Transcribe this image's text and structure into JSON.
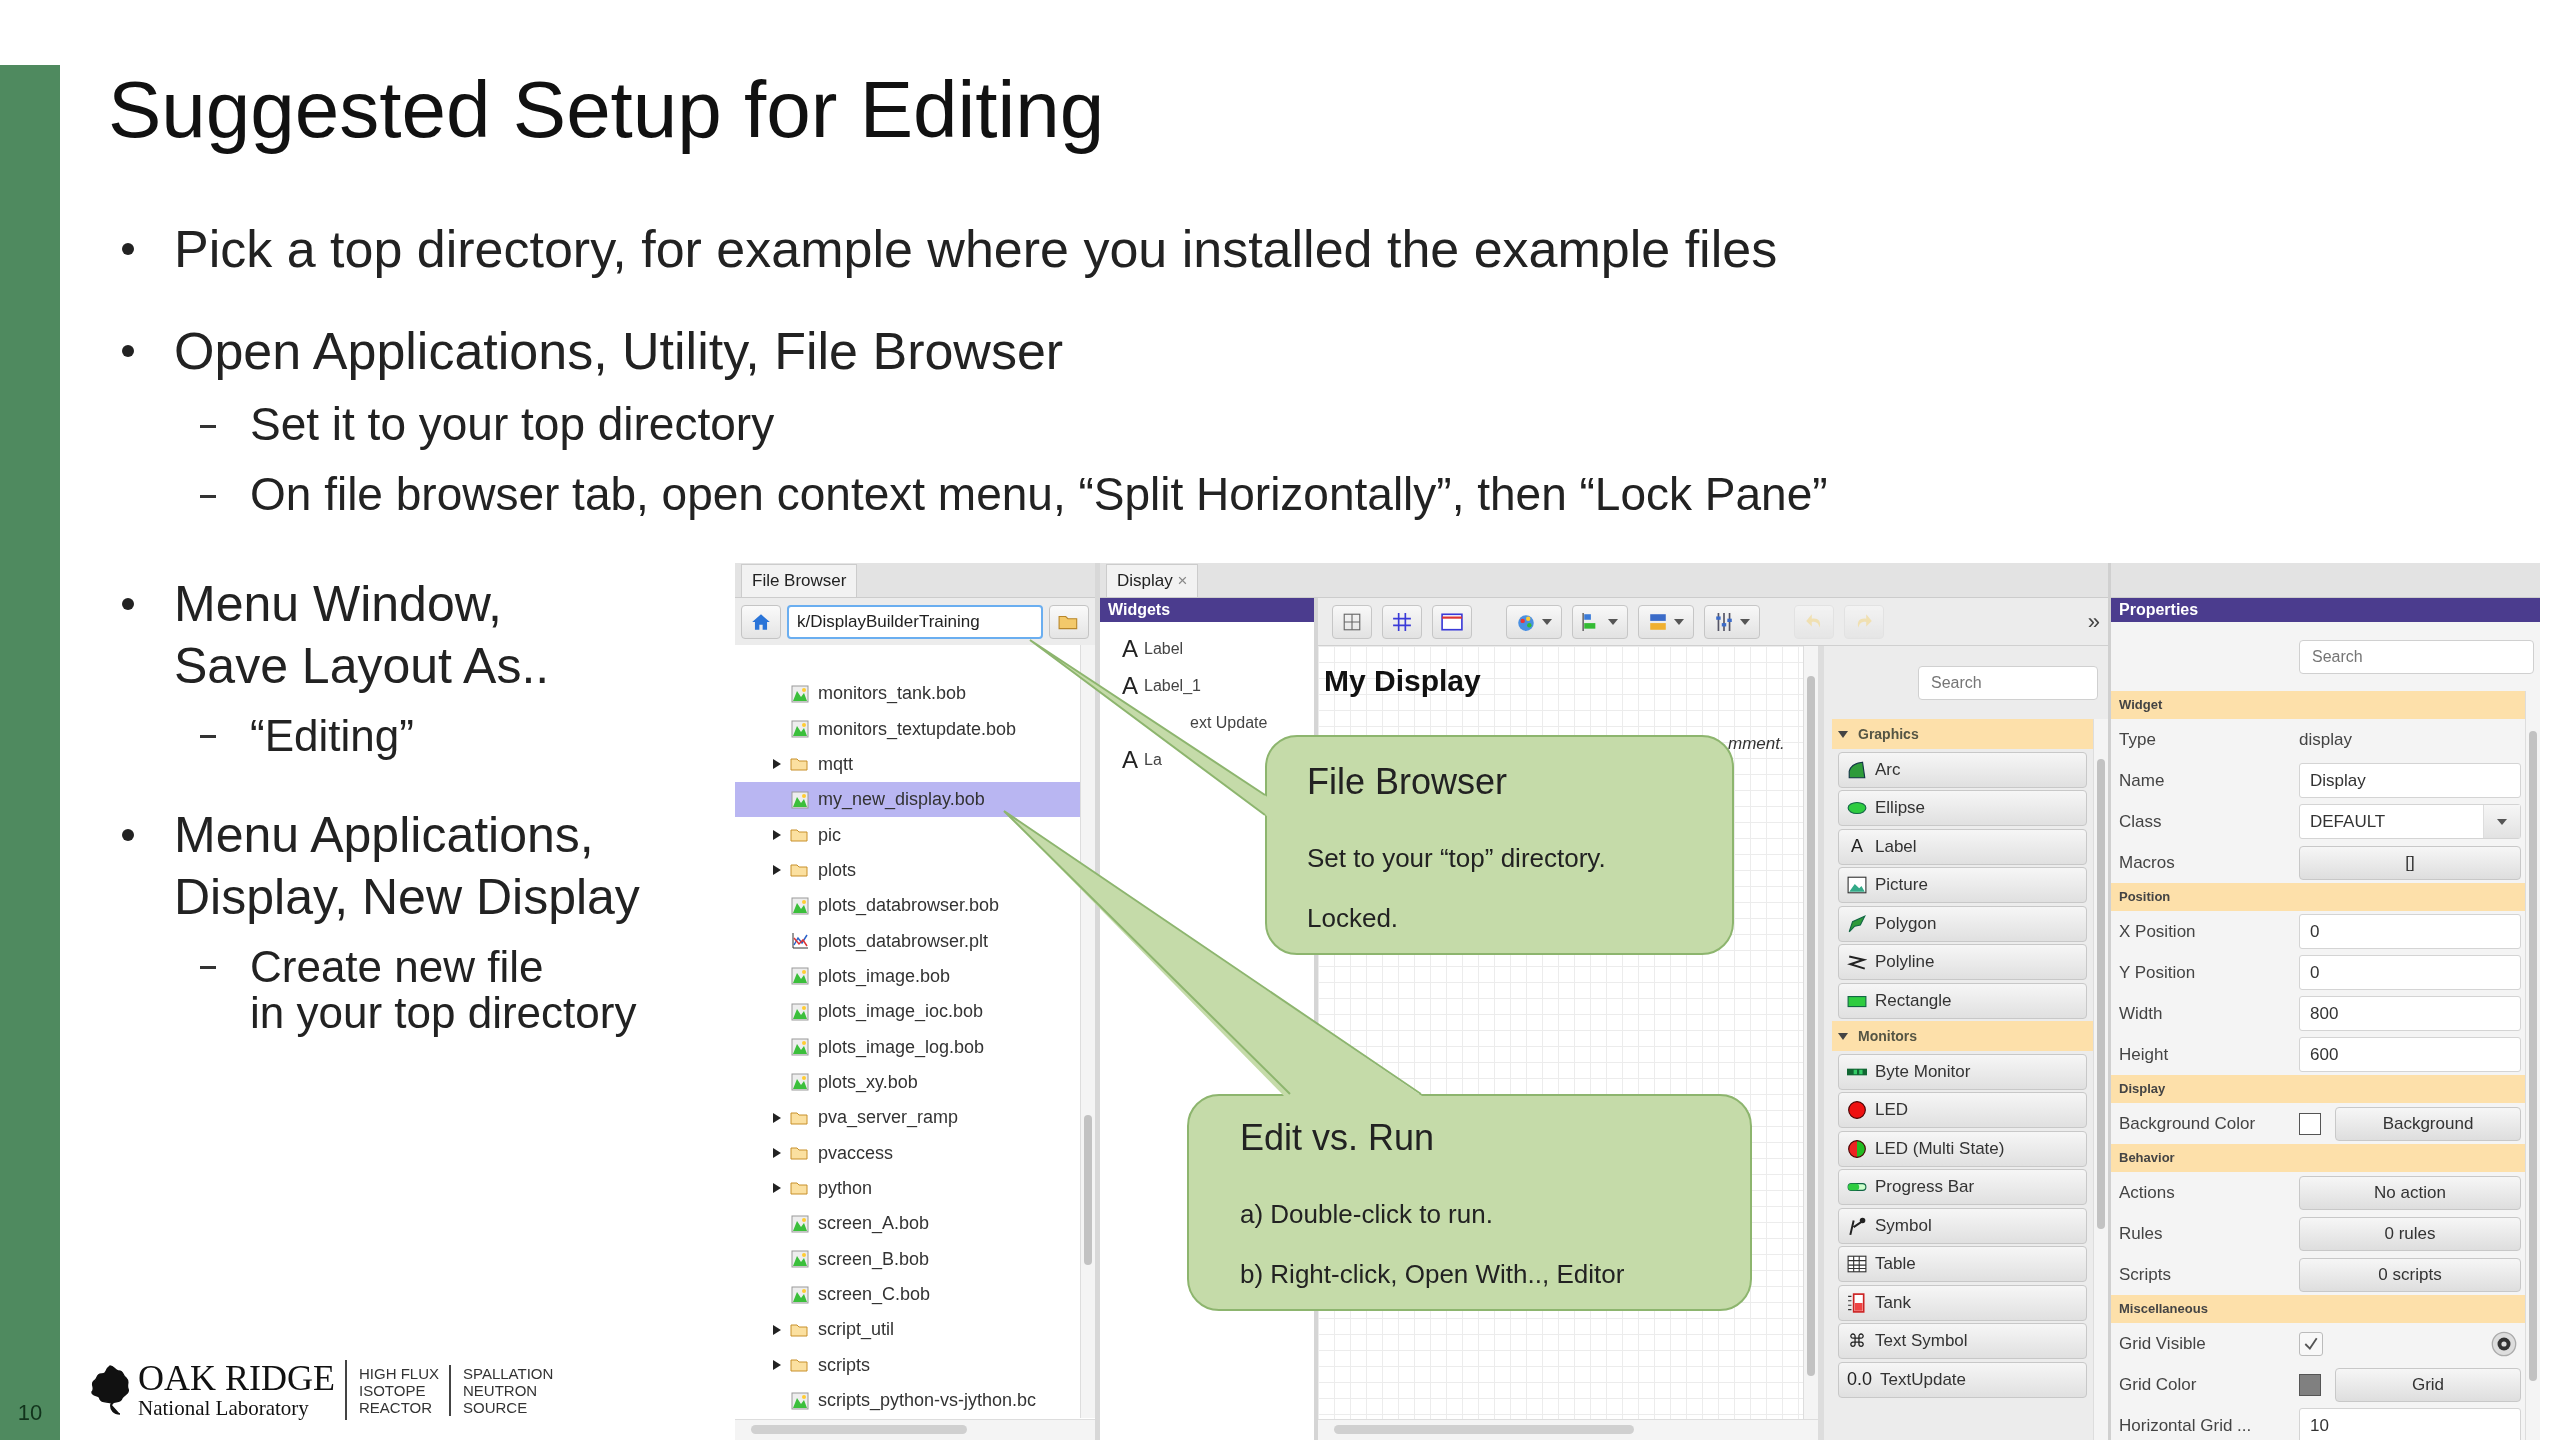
{
  "slide": {
    "title": "Suggested Setup for Editing",
    "page_number": "10"
  },
  "bullets_top": [
    {
      "text": "Pick a top directory, for example where you installed the example files"
    },
    {
      "text": "Open Applications, Utility, File Browser",
      "subs": [
        "Set it to your top directory",
        "On file browser tab, open context menu, “Split Horizontally”, then “Lock Pane”"
      ]
    }
  ],
  "bullets_side": [
    {
      "text": "Menu Window,\nSave Layout As..",
      "subs": [
        "“Editing”"
      ]
    },
    {
      "text": "Menu Applications,\nDisplay, New Display",
      "subs": [
        "Create new file\nin your top directory"
      ]
    }
  ],
  "logo": {
    "name": "OAK RIDGE",
    "subtitle": "National Laboratory",
    "units": [
      [
        "HIGH FLUX",
        "ISOTOPE",
        "REACTOR"
      ],
      [
        "SPALLATION",
        "NEUTRON",
        "SOURCE"
      ]
    ]
  },
  "file_browser": {
    "tab": "File Browser",
    "path": "k/DisplayBuilderTraining",
    "items": [
      {
        "name": "monitors_tank.bob",
        "kind": "file",
        "selected": false
      },
      {
        "name": "monitors_textupdate.bob",
        "kind": "file",
        "selected": false
      },
      {
        "name": "mqtt",
        "kind": "folder",
        "selected": false,
        "expanded": false
      },
      {
        "name": "my_new_display.bob",
        "kind": "file",
        "selected": true
      },
      {
        "name": "pic",
        "kind": "folder",
        "selected": false,
        "expanded": false
      },
      {
        "name": "plots",
        "kind": "folder",
        "selected": false,
        "expanded": false
      },
      {
        "name": "plots_databrowser.bob",
        "kind": "file",
        "selected": false
      },
      {
        "name": "plots_databrowser.plt",
        "kind": "plot",
        "selected": false
      },
      {
        "name": "plots_image.bob",
        "kind": "file",
        "selected": false
      },
      {
        "name": "plots_image_ioc.bob",
        "kind": "file",
        "selected": false
      },
      {
        "name": "plots_image_log.bob",
        "kind": "file",
        "selected": false
      },
      {
        "name": "plots_xy.bob",
        "kind": "file",
        "selected": false
      },
      {
        "name": "pva_server_ramp",
        "kind": "folder",
        "selected": false,
        "expanded": false
      },
      {
        "name": "pvaccess",
        "kind": "folder",
        "selected": false,
        "expanded": false
      },
      {
        "name": "python",
        "kind": "folder",
        "selected": false,
        "expanded": false
      },
      {
        "name": "screen_A.bob",
        "kind": "file",
        "selected": false
      },
      {
        "name": "screen_B.bob",
        "kind": "file",
        "selected": false
      },
      {
        "name": "screen_C.bob",
        "kind": "file",
        "selected": false
      },
      {
        "name": "script_util",
        "kind": "folder",
        "selected": false,
        "expanded": false
      },
      {
        "name": "scripts",
        "kind": "folder",
        "selected": false,
        "expanded": false
      },
      {
        "name": "scripts_python-vs-jython.bc",
        "kind": "file",
        "selected": false
      }
    ]
  },
  "display": {
    "tab": "Display",
    "tab_close": "×",
    "toolbar_overflow": "»",
    "outline": {
      "title": "Widgets",
      "items": [
        {
          "label": "Label",
          "icon_text": "A"
        },
        {
          "label": "Label_1",
          "icon_text": "A"
        },
        {
          "label": "ext Update"
        },
        {
          "label": "La",
          "icon_text": "A"
        }
      ]
    },
    "canvas": {
      "title": "My Display",
      "comment": "mment."
    },
    "palette": {
      "search_placeholder": "Search",
      "sections": [
        {
          "title": "Graphics",
          "expanded": true,
          "items": [
            {
              "label": "Arc",
              "kind": "arc"
            },
            {
              "label": "Ellipse",
              "kind": "ellipse"
            },
            {
              "label": "Label",
              "kind": "text",
              "icon_text": "A"
            },
            {
              "label": "Picture",
              "kind": "picture"
            },
            {
              "label": "Polygon",
              "kind": "polygon"
            },
            {
              "label": "Polyline",
              "kind": "polyline"
            },
            {
              "label": "Rectangle",
              "kind": "rectangle"
            }
          ]
        },
        {
          "title": "Monitors",
          "expanded": true,
          "items": [
            {
              "label": "Byte Monitor",
              "kind": "byte"
            },
            {
              "label": "LED",
              "kind": "led"
            },
            {
              "label": "LED (Multi State)",
              "kind": "multiled"
            },
            {
              "label": "Progress Bar",
              "kind": "progress"
            },
            {
              "label": "Symbol",
              "kind": "symbol"
            },
            {
              "label": "Table",
              "kind": "table"
            },
            {
              "label": "Tank",
              "kind": "tank"
            },
            {
              "label": "Text Symbol",
              "kind": "text",
              "icon_text": "⌘"
            },
            {
              "label": "TextUpdate",
              "kind": "text",
              "icon_text": "0.0"
            }
          ]
        }
      ]
    }
  },
  "properties": {
    "title": "Properties",
    "search_placeholder": "Search",
    "rows": [
      {
        "kind": "section",
        "label": "Widget"
      },
      {
        "kind": "text",
        "label": "Type",
        "value": "display"
      },
      {
        "kind": "field",
        "label": "Name",
        "value": "Display"
      },
      {
        "kind": "dropdown",
        "label": "Class",
        "value": "DEFAULT"
      },
      {
        "kind": "button",
        "label": "Macros",
        "value": "[]"
      },
      {
        "kind": "section",
        "label": "Position"
      },
      {
        "kind": "field",
        "label": "X Position",
        "value": "0"
      },
      {
        "kind": "field",
        "label": "Y Position",
        "value": "0"
      },
      {
        "kind": "field",
        "label": "Width",
        "value": "800"
      },
      {
        "kind": "field",
        "label": "Height",
        "value": "600"
      },
      {
        "kind": "section",
        "label": "Display"
      },
      {
        "kind": "color",
        "label": "Background Color",
        "color": "#ffffff",
        "value": "Background"
      },
      {
        "kind": "section",
        "label": "Behavior"
      },
      {
        "kind": "button",
        "label": "Actions",
        "value": "No action"
      },
      {
        "kind": "button",
        "label": "Rules",
        "value": "0 rules"
      },
      {
        "kind": "button",
        "label": "Scripts",
        "value": "0 scripts"
      },
      {
        "kind": "section",
        "label": "Miscellaneous"
      },
      {
        "kind": "check",
        "label": "Grid Visible",
        "checked": true
      },
      {
        "kind": "color",
        "label": "Grid Color",
        "color": "#808080",
        "value": "Grid"
      },
      {
        "kind": "field",
        "label": "Horizontal Grid ...",
        "value": "10"
      }
    ]
  },
  "callouts": [
    {
      "title": "File Browser",
      "lines": [
        "Set to your “top” directory.",
        "Locked."
      ]
    },
    {
      "title": "Edit vs. Run",
      "lines": [
        "a) Double-click to run.",
        "b) Right-click, Open With.., Editor"
      ]
    }
  ]
}
